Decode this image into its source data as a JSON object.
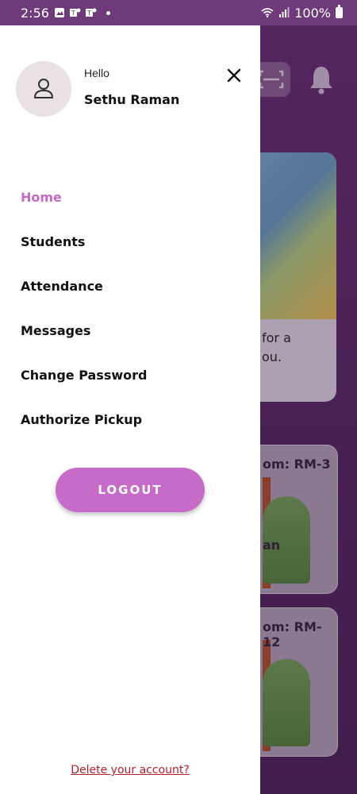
{
  "status_bar": {
    "time": "2:56",
    "battery": "100%",
    "icons": [
      "image-icon",
      "teams-icon",
      "teams-icon",
      "dot-icon",
      "wifi-icon",
      "signal-icon",
      "battery-icon"
    ]
  },
  "drawer": {
    "greeting": "Hello",
    "user_name": "Sethu Raman",
    "menu": [
      {
        "label": "Home",
        "active": true
      },
      {
        "label": "Students",
        "active": false
      },
      {
        "label": "Attendance",
        "active": false
      },
      {
        "label": "Messages",
        "active": false
      },
      {
        "label": "Change Password",
        "active": false
      },
      {
        "label": "Authorize Pickup",
        "active": false
      }
    ],
    "logout_label": "LOGOUT",
    "delete_label": "Delete your account?"
  },
  "background": {
    "banner_text_line1": "for a",
    "banner_text_line2": "ou.",
    "rooms": [
      {
        "label": "om: RM-3",
        "sub": "an"
      },
      {
        "label": "om: RM-12"
      }
    ]
  },
  "colors": {
    "accent": "#c66bc7",
    "active_menu": "#c26ac6",
    "status_bar": "#6e3a7a",
    "delete_link": "#b3202a"
  }
}
